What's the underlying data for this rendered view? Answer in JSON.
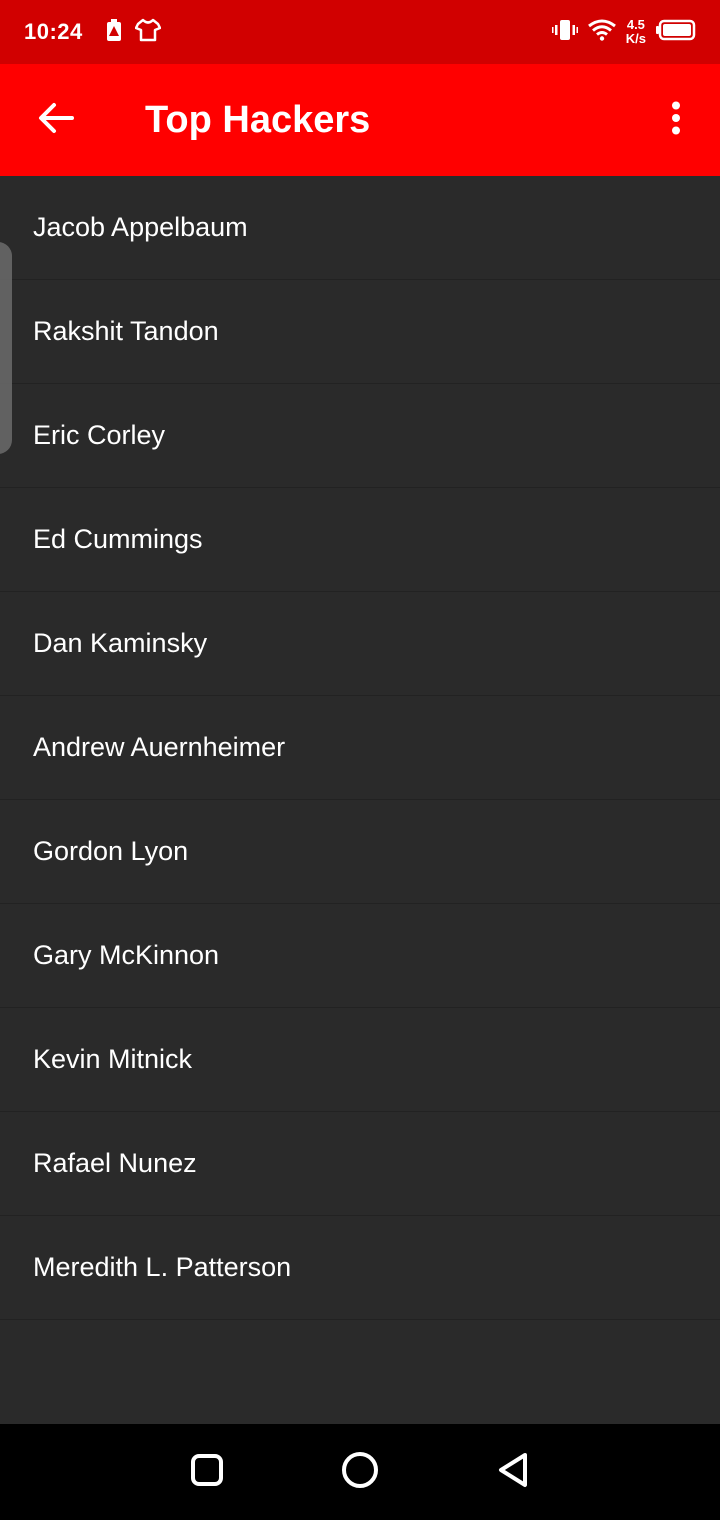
{
  "status_bar": {
    "time": "10:24",
    "net_speed_value": "4.5",
    "net_speed_unit": "K/s"
  },
  "app_bar": {
    "title": "Top Hackers"
  },
  "hackers": [
    "Jacob Appelbaum",
    "Rakshit Tandon",
    "Eric Corley",
    "Ed Cummings",
    "Dan Kaminsky",
    "Andrew Auernheimer",
    "Gordon Lyon",
    "Gary McKinnon",
    "Kevin Mitnick",
    "Rafael Nunez",
    "Meredith L. Patterson"
  ],
  "colors": {
    "status_bar_bg": "#d10000",
    "app_bar_bg": "#ff0000",
    "list_bg": "#2a2a2a",
    "nav_bar_bg": "#000000"
  }
}
